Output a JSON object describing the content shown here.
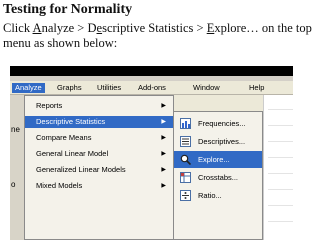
{
  "slide": {
    "title": "Testing for Normality",
    "instruction": [
      "Click ",
      "A",
      "nalyze > D",
      "e",
      "scriptive Statistics > ",
      "E",
      "xplore… on the top menu as shown below:"
    ]
  },
  "menubar": {
    "items": [
      "Analyze",
      "Graphs",
      "Utilities",
      "Add-ons",
      "Window",
      "Help"
    ],
    "active": "Analyze"
  },
  "left_strip": {
    "fragments": [
      "ne",
      "o"
    ]
  },
  "analyze_menu": {
    "items": [
      {
        "label": "Reports",
        "has_submenu": true
      },
      {
        "label": "Descriptive Statistics",
        "has_submenu": true,
        "highlighted": true
      },
      {
        "label": "Compare Means",
        "has_submenu": true
      },
      {
        "label": "General Linear Model",
        "has_submenu": true
      },
      {
        "label": "Generalized Linear Models",
        "has_submenu": true
      },
      {
        "label": "Mixed Models",
        "has_submenu": true
      }
    ]
  },
  "descriptive_submenu": {
    "items": [
      {
        "label": "Frequencies...",
        "icon": "frequencies-icon"
      },
      {
        "label": "Descriptives...",
        "icon": "descriptives-icon"
      },
      {
        "label": "Explore...",
        "icon": "explore-icon",
        "highlighted": true
      },
      {
        "label": "Crosstabs...",
        "icon": "crosstabs-icon"
      },
      {
        "label": "Ratio...",
        "icon": "ratio-icon"
      }
    ]
  },
  "colors": {
    "highlight": "#316ac5",
    "menu_bg": "#f4f2ea",
    "chrome": "#ece9d8"
  }
}
